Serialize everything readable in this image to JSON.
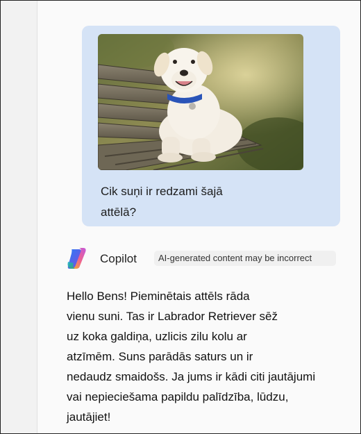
{
  "user_message": {
    "image_alt": "Labrador Retriever dog lying on a wooden bench with a blue collar",
    "question_lines": [
      "Cik suņi ir redzami šajā",
      "attēlā?"
    ]
  },
  "assistant": {
    "name": "Copilot",
    "disclaimer": "AI-generated content may be incorrect",
    "response_lines": [
      "Hello Bens! Pieminētais attēls rāda",
      "vienu suni. Tas ir Labrador Retriever sēž",
      "uz koka galdiņa, uzlicis zilu kolu ar",
      "atzīmēm. Suns parādās saturs un ir",
      "nedaudz smaidošs. Ja jums ir kādi citi jautājumi",
      "vai nepieciešama papildu palīdzība, lūdzu,",
      "jautājiet!"
    ]
  },
  "colors": {
    "user_bubble": "#d5e3f6",
    "disclaimer_bg": "#f0f0f0",
    "collar": "#2a54b8"
  },
  "icons": {
    "assistant_logo": "copilot-logo-icon"
  }
}
